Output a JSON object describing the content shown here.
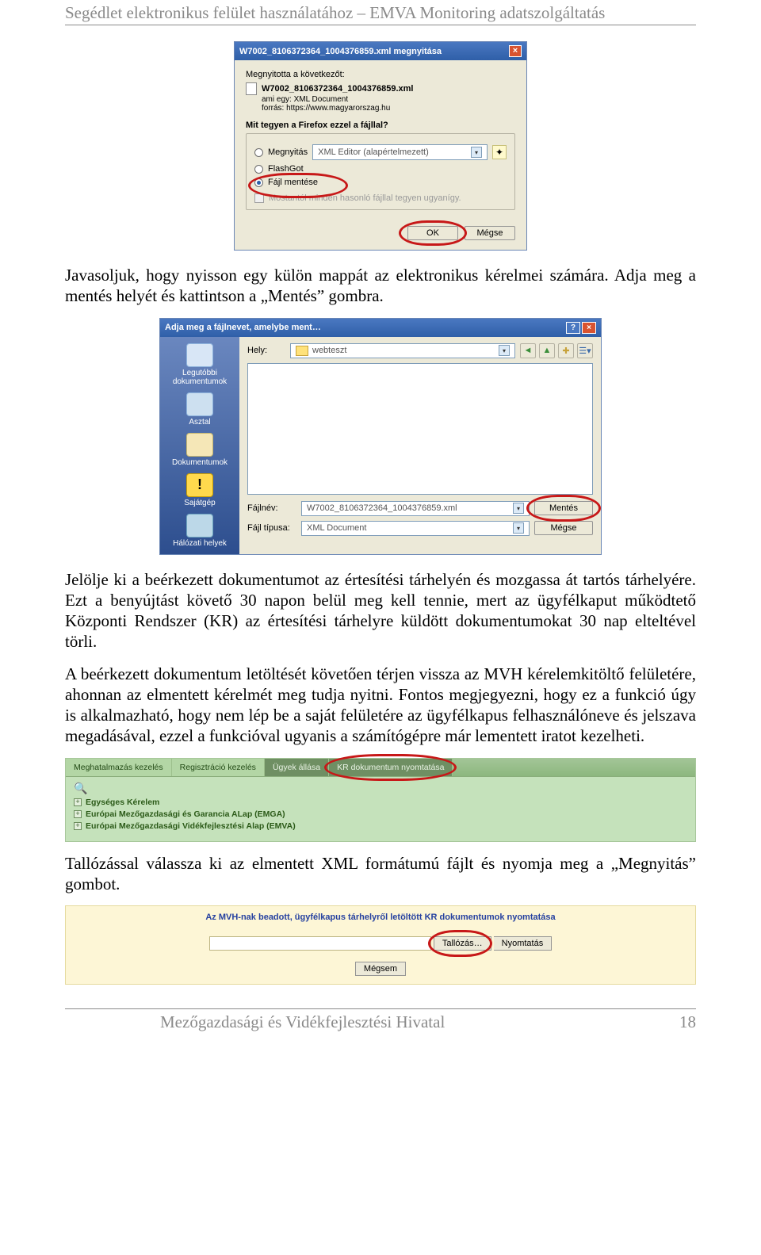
{
  "header": "Segédlet elektronikus felület használatához – EMVA Monitoring adatszolgáltatás",
  "paragraph1": "Javasoljuk, hogy nyisson egy külön mappát az elektronikus kérelmei számára. Adja meg a mentés helyét és kattintson a „Mentés” gombra.",
  "paragraph2": "Jelölje ki a beérkezett dokumentumot az értesítési tárhelyén és mozgassa át tartós tárhelyére. Ezt a benyújtást követő 30 napon belül meg kell tennie, mert az ügyfélkaput működtető Központi Rendszer (KR) az értesítési tárhelyre küldött dokumentumokat 30 nap elteltével törli.",
  "paragraph3": "A beérkezett dokumentum letöltését követően térjen vissza az MVH kérelemkitöltő felületére, ahonnan az elmentett kérelmét meg tudja nyitni. Fontos megjegyezni, hogy ez a funkció úgy is alkalmazható, hogy nem lép be a saját felületére az ügyfélkapus felhasználóneve és jelszava megadásával, ezzel a funkcióval ugyanis a számítógépre már lementett iratot kezelheti.",
  "paragraph4": "Tallózással válassza ki az elmentett XML formátumú fájlt és nyomja meg a „Megnyitás” gombot.",
  "footer": {
    "org": "Mezőgazdasági és Vidékfejlesztési Hivatal",
    "page": "18"
  },
  "dlg1": {
    "title": "W7002_8106372364_1004376859.xml megnyitása",
    "opening_label": "Megnyitotta a következőt:",
    "file_name": "W7002_8106372364_1004376859.xml",
    "file_type_line": "ami egy: XML Document",
    "source_line": "forrás: https://www.magyarorszag.hu",
    "group_label": "Mit tegyen a Firefox ezzel a fájllal?",
    "radio_open": "Megnyitás",
    "open_with": "XML Editor (alapértelmezett)",
    "radio_flashgot": "FlashGot",
    "radio_save": "Fájl mentése",
    "remember": "Mostantól minden hasonló fájllal tegyen ugyanígy.",
    "ok": "OK",
    "cancel": "Mégse"
  },
  "dlg2": {
    "title": "Adja meg a fájlnevet, amelybe ment…",
    "loc_label": "Hely:",
    "loc_value": "webteszt",
    "sidebar": {
      "recent": "Legutóbbi dokumentumok",
      "desktop": "Asztal",
      "mydocs": "Dokumentumok",
      "mycomputer": "Sajátgép",
      "network": "Hálózati helyek"
    },
    "file_label": "Fájlnév:",
    "file_value": "W7002_8106372364_1004376859.xml",
    "type_label": "Fájl típusa:",
    "type_value": "XML Document",
    "save": "Mentés",
    "cancel": "Mégse"
  },
  "green": {
    "tab_meghat": "Meghatalmazás kezelés",
    "tab_reg": "Regisztráció kezelés",
    "tab_ugyek": "Ügyek állása",
    "tab_kr": "KR dokumentum nyomtatása",
    "tree1": "Egységes Kérelem",
    "tree2": "Európai Mezőgazdasági és Garancia ALap (EMGA)",
    "tree3": "Európai Mezőgazdasági Vidékfejlesztési Alap (EMVA)"
  },
  "kr": {
    "title": "Az MVH-nak beadott, ügyfélkapus tárhelyről letöltött KR dokumentumok nyomtatása",
    "browse": "Tallózás…",
    "print": "Nyomtatás",
    "cancel": "Mégsem"
  }
}
